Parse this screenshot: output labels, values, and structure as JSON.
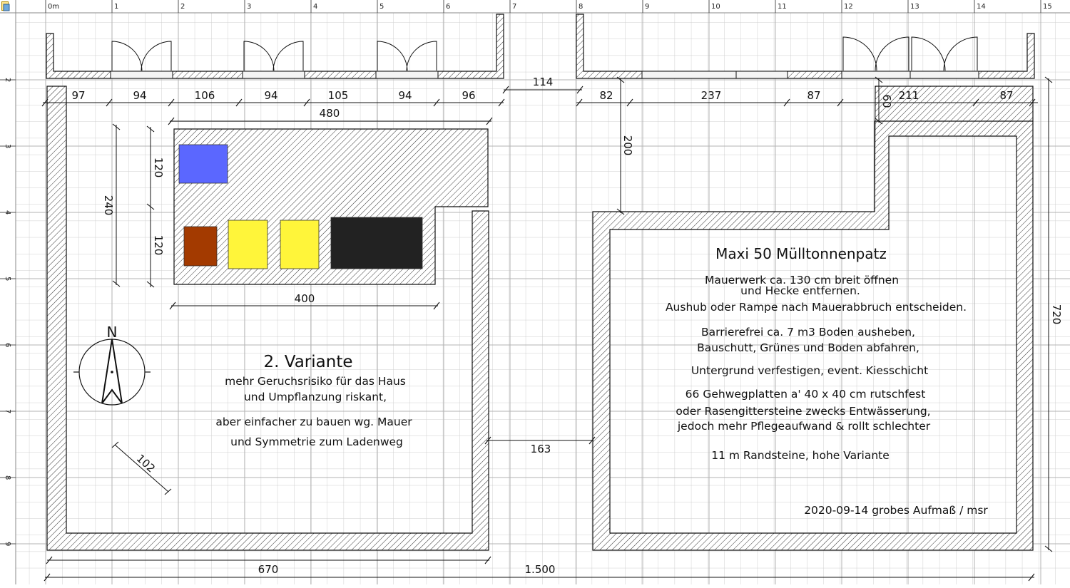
{
  "window": {
    "accent": "#3C78D8"
  },
  "ruler": {
    "h_labels": [
      "0m",
      "1",
      "2",
      "3",
      "4",
      "5",
      "6",
      "7",
      "8",
      "9",
      "10",
      "11",
      "12",
      "13",
      "14",
      "15"
    ],
    "v_labels": [
      "2",
      "3",
      "4",
      "5",
      "6",
      "7",
      "8",
      "9"
    ]
  },
  "dimensions": {
    "top_left": [
      "97",
      "94",
      "106",
      "94",
      "105",
      "94",
      "96"
    ],
    "gap_top": "114",
    "top_right": [
      "82",
      "237",
      "87",
      "211",
      "87"
    ],
    "right_notch_v": "60",
    "right_notch_depth": "200",
    "platform_width": "480",
    "platform_depth": "240",
    "platform_row_upper": "120",
    "platform_row_lower": "120",
    "platform_lower_width": "400",
    "gap_middle": "163",
    "right_height": "720",
    "diag": "102",
    "bottom_left": "670",
    "bottom_total": "1.500"
  },
  "left_text": {
    "title": "2. Variante",
    "lines": [
      "mehr Geruchsrisiko für das Haus",
      "und Umpflanzung riskant,",
      "aber einfacher zu bauen wg. Mauer",
      "und Symmetrie zum Ladenweg"
    ]
  },
  "right_text": {
    "title": "Maxi 50 Mülltonnenpatz",
    "lines": [
      "Mauerwerk ca. 130 cm breit öffnen",
      "und Hecke entfernen.",
      "Aushub oder Rampe nach Mauerabbruch entscheiden.",
      "Barrierefrei ca. 7 m3 Boden ausheben,",
      "Bauschutt, Grünes und Boden abfahren,",
      "Untergrund verfestigen, event. Kiesschicht",
      "66 Gehwegplatten a' 40 x 40 cm rutschfest",
      "oder Rasengittersteine zwecks Entwässerung,",
      "jedoch mehr Pflegeaufwand & rollt schlechter",
      "11 m Randsteine, hohe Variante"
    ],
    "footer": "2020-09-14 grobes Aufmaß / msr"
  },
  "compass": {
    "label": "N",
    "icon": "north-arrow-icon"
  },
  "bins": [
    {
      "name": "bin-blue",
      "color": "#5B67FF"
    },
    {
      "name": "bin-brown",
      "color": "#A33A00"
    },
    {
      "name": "bin-yellow-1",
      "color": "#FFF53A"
    },
    {
      "name": "bin-yellow-2",
      "color": "#FFF53A"
    },
    {
      "name": "bin-black",
      "color": "#222222"
    }
  ],
  "colors": {
    "grid": "#C9C9C9",
    "line": "#111111",
    "window_sill": "#F4F4F4"
  }
}
